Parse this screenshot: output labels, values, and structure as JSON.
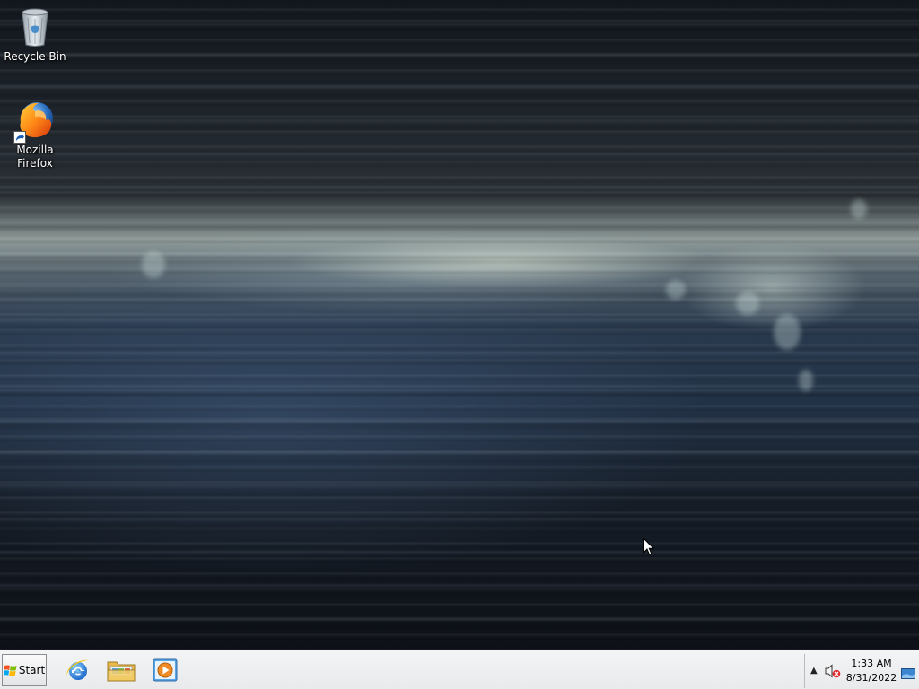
{
  "desktop": {
    "icons": [
      {
        "label": "Recycle Bin",
        "icon": "recycle-bin-icon"
      },
      {
        "label": "Mozilla Firefox",
        "icon": "firefox-icon"
      }
    ]
  },
  "taskbar": {
    "start_label": "Start",
    "quick_launch": [
      {
        "icon": "internet-explorer-icon"
      },
      {
        "icon": "windows-explorer-icon"
      },
      {
        "icon": "windows-media-player-icon"
      }
    ],
    "tray": {
      "time": "1:33 AM",
      "date": "8/31/2022",
      "volume_state": "muted"
    }
  }
}
